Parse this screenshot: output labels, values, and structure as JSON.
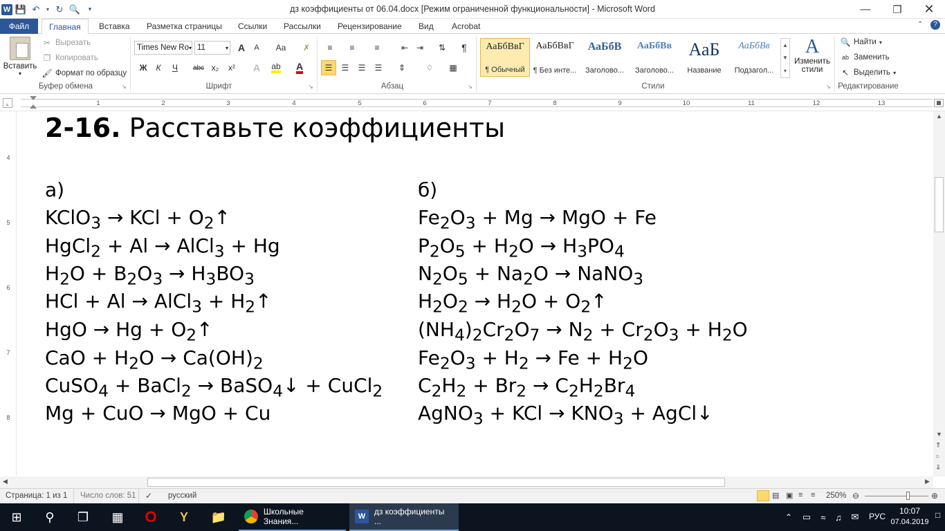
{
  "titlebar": {
    "title": "дз коэффициенты от 06.04.docx [Режим ограниченной функциональности]  -  Microsoft Word",
    "app_icon": "word-icon"
  },
  "tabs": [
    {
      "label": "Файл"
    },
    {
      "label": "Главная"
    },
    {
      "label": "Вставка"
    },
    {
      "label": "Разметка страницы"
    },
    {
      "label": "Ссылки"
    },
    {
      "label": "Рассылки"
    },
    {
      "label": "Рецензирование"
    },
    {
      "label": "Вид"
    },
    {
      "label": "Acrobat"
    }
  ],
  "clipboard": {
    "paste": "Вставить",
    "cut": "Вырезать",
    "copy": "Копировать",
    "format_painter": "Формат по образцу",
    "group": "Буфер обмена"
  },
  "font": {
    "name": "Times New Ro",
    "size": "11",
    "group": "Шрифт",
    "bold": "Ж",
    "italic": "К",
    "underline": "Ч",
    "strike": "abc",
    "sub": "x₂",
    "sup": "x²",
    "grow": "A",
    "shrink": "A",
    "case": "Aa",
    "color_letter": "A"
  },
  "paragraph": {
    "group": "Абзац"
  },
  "styles": {
    "group": "Стили",
    "items": [
      {
        "preview": "АаБбВвГ",
        "name": "¶ Обычный"
      },
      {
        "preview": "АаБбВвГ",
        "name": "¶ Без инте..."
      },
      {
        "preview": "АаБбВ",
        "name": "Заголово..."
      },
      {
        "preview": "АаБбВв",
        "name": "Заголово..."
      },
      {
        "preview": "АаБ",
        "name": "Название"
      },
      {
        "preview": "АаБбВв",
        "name": "Подзагол..."
      }
    ],
    "change_styles_1": "Изменить",
    "change_styles_2": "стили"
  },
  "editing": {
    "find": "Найти",
    "replace": "Заменить",
    "select": "Выделить",
    "group": "Редактирование"
  },
  "ruler": {
    "numbers": [
      "1",
      "2",
      "3",
      "4",
      "5",
      "6",
      "7",
      "8",
      "9",
      "10",
      "11",
      "12",
      "13"
    ]
  },
  "vruler": {
    "numbers": [
      "4",
      "5",
      "6",
      "7",
      "8"
    ]
  },
  "document": {
    "heading_num": "2-16.",
    "heading_text": "Расставьте коэффициенты",
    "col_a_label": "а)",
    "col_b_label": "б)"
  },
  "status": {
    "page": "Страница: 1 из 1",
    "words": "Число слов: 51",
    "language": "русский",
    "zoom": "250%"
  },
  "taskbar": {
    "app1": "Школьные Знания...",
    "app2": "дз коэффициенты ...",
    "lang": "РУС",
    "time": "10:07",
    "date": "07.04.2019"
  }
}
